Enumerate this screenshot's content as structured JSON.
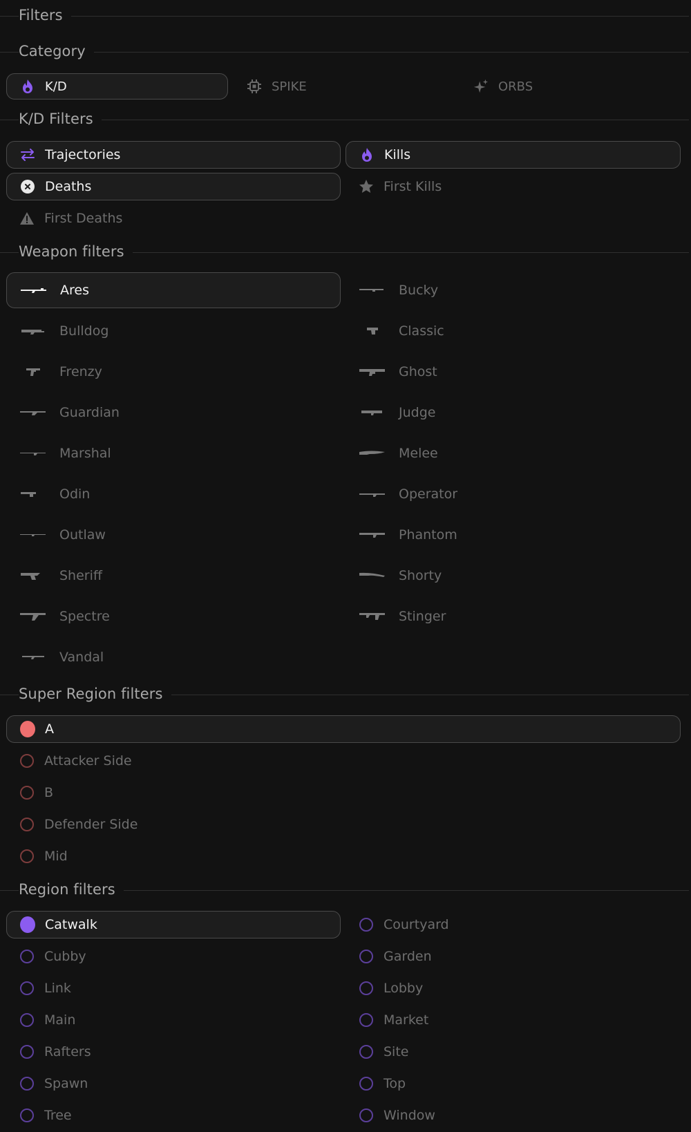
{
  "filters_title": "Filters",
  "category": {
    "title": "Category",
    "items": [
      {
        "label": "K/D",
        "icon": "flame-icon",
        "selected": true
      },
      {
        "label": "SPIKE",
        "icon": "chip-icon",
        "selected": false
      },
      {
        "label": "ORBS",
        "icon": "sparkle-icon",
        "selected": false
      }
    ]
  },
  "kd_filters": {
    "title": "K/D Filters",
    "items": [
      {
        "label": "Trajectories",
        "icon": "swap-arrows-icon",
        "selected": true
      },
      {
        "label": "Kills",
        "icon": "flame-icon",
        "selected": true
      },
      {
        "label": "Deaths",
        "icon": "x-circle-icon",
        "selected": true
      },
      {
        "label": "First Kills",
        "icon": "star-icon",
        "selected": false
      },
      {
        "label": "First Deaths",
        "icon": "warning-icon",
        "selected": false
      }
    ]
  },
  "weapon_filters": {
    "title": "Weapon filters",
    "items": [
      {
        "label": "Ares",
        "selected": true
      },
      {
        "label": "Bucky",
        "selected": false
      },
      {
        "label": "Bulldog",
        "selected": false
      },
      {
        "label": "Classic",
        "selected": false
      },
      {
        "label": "Frenzy",
        "selected": false
      },
      {
        "label": "Ghost",
        "selected": false
      },
      {
        "label": "Guardian",
        "selected": false
      },
      {
        "label": "Judge",
        "selected": false
      },
      {
        "label": "Marshal",
        "selected": false
      },
      {
        "label": "Melee",
        "selected": false
      },
      {
        "label": "Odin",
        "selected": false
      },
      {
        "label": "Operator",
        "selected": false
      },
      {
        "label": "Outlaw",
        "selected": false
      },
      {
        "label": "Phantom",
        "selected": false
      },
      {
        "label": "Sheriff",
        "selected": false
      },
      {
        "label": "Shorty",
        "selected": false
      },
      {
        "label": "Spectre",
        "selected": false
      },
      {
        "label": "Stinger",
        "selected": false
      },
      {
        "label": "Vandal",
        "selected": false
      }
    ]
  },
  "super_region_filters": {
    "title": "Super Region filters",
    "color": "#ef6f6f",
    "items": [
      {
        "label": "A",
        "selected": true
      },
      {
        "label": "Attacker Side",
        "selected": false
      },
      {
        "label": "B",
        "selected": false
      },
      {
        "label": "Defender Side",
        "selected": false
      },
      {
        "label": "Mid",
        "selected": false
      }
    ]
  },
  "region_filters": {
    "title": "Region filters",
    "color": "#8b5cf0",
    "items": [
      {
        "label": "Catwalk",
        "selected": true
      },
      {
        "label": "Courtyard",
        "selected": false
      },
      {
        "label": "Cubby",
        "selected": false
      },
      {
        "label": "Garden",
        "selected": false
      },
      {
        "label": "Link",
        "selected": false
      },
      {
        "label": "Lobby",
        "selected": false
      },
      {
        "label": "Main",
        "selected": false
      },
      {
        "label": "Market",
        "selected": false
      },
      {
        "label": "Rafters",
        "selected": false
      },
      {
        "label": "Site",
        "selected": false
      },
      {
        "label": "Spawn",
        "selected": false
      },
      {
        "label": "Top",
        "selected": false
      },
      {
        "label": "Tree",
        "selected": false
      },
      {
        "label": "Window",
        "selected": false
      }
    ]
  }
}
